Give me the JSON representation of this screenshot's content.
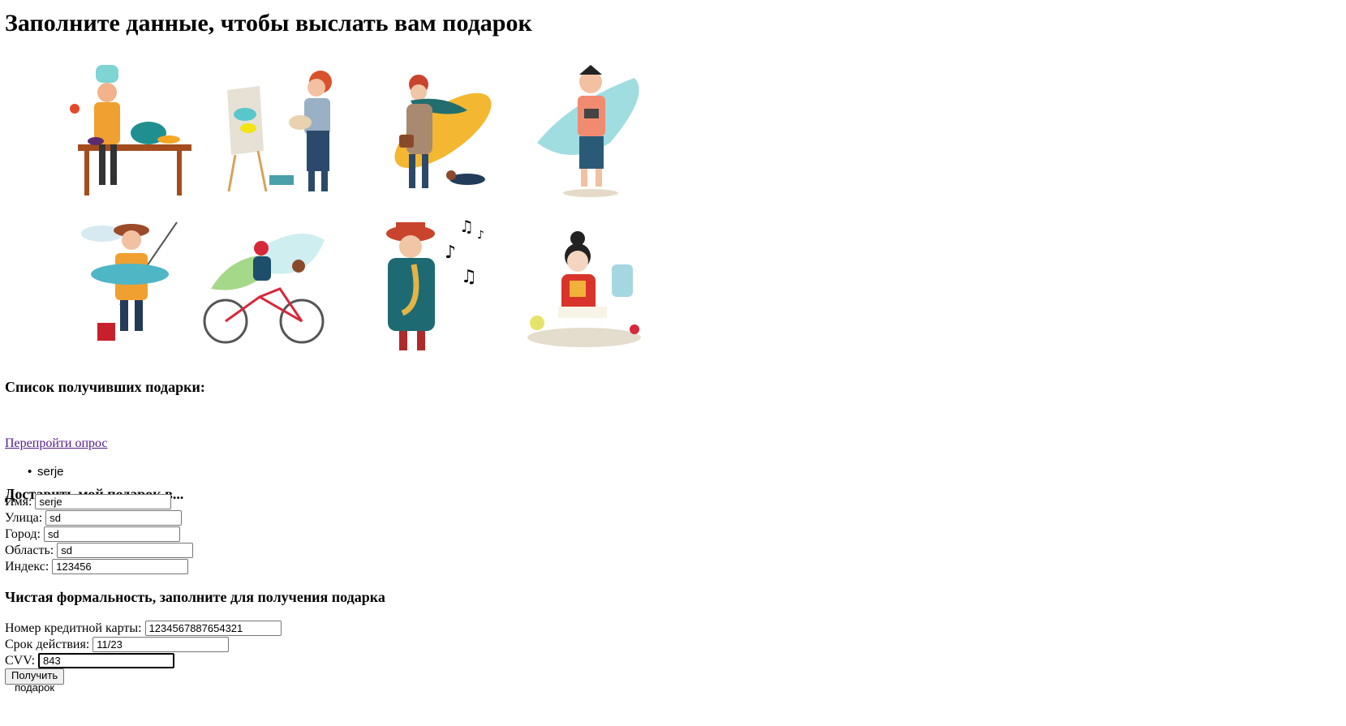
{
  "page": {
    "title": "Заполните данные, чтобы выслать вам подарок"
  },
  "gallery": [
    {
      "name": "chef-illustration"
    },
    {
      "name": "painter-illustration"
    },
    {
      "name": "autumn-walker-illustration"
    },
    {
      "name": "photographer-illustration"
    },
    {
      "name": "fisherman-illustration"
    },
    {
      "name": "cyclist-illustration"
    },
    {
      "name": "saxophonist-illustration"
    },
    {
      "name": "reader-illustration"
    }
  ],
  "recipients": {
    "heading": "Список получивших подарки:",
    "retake_link": "Перепройти опрос",
    "items": [
      "serje"
    ]
  },
  "delivery": {
    "heading": "Доставить мой подарок в...",
    "fields": {
      "name": {
        "label": "Имя:",
        "value": "serje"
      },
      "street": {
        "label": "Улица:",
        "value": "sd"
      },
      "city": {
        "label": "Город:",
        "value": "sd"
      },
      "region": {
        "label": "Область:",
        "value": "sd"
      },
      "index": {
        "label": "Индекс:",
        "value": "123456"
      }
    }
  },
  "payment": {
    "heading": "Чистая формальность, заполните для получения подарка",
    "fields": {
      "card": {
        "label": "Номер кредитной карты:",
        "value": "1234567887654321"
      },
      "expiry": {
        "label": "Срок действия:",
        "value": "11/23"
      },
      "cvv": {
        "label": "CVV:",
        "value": "843"
      }
    },
    "submit_label": "Получить подарок"
  }
}
